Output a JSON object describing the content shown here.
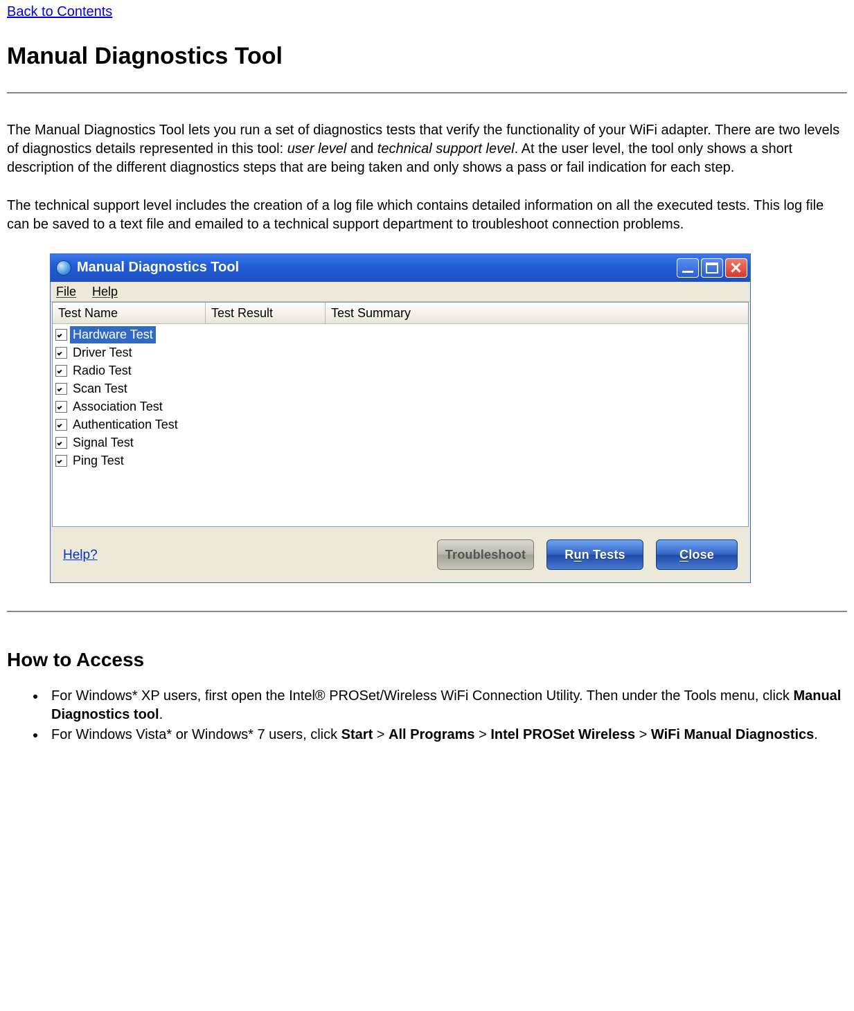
{
  "nav": {
    "back_to_contents": "Back to Contents"
  },
  "h1": "Manual Diagnostics Tool",
  "p1_a": "The Manual Diagnostics Tool lets you run a set of diagnostics tests that verify the functionality of your WiFi adapter. There are two levels of diagnostics details represented in this tool: ",
  "p1_user_level": "user level",
  "p1_and": " and ",
  "p1_tech_level": "technical support level",
  "p1_b": ". At the user level, the tool only shows a short description of the different diagnostics steps that are being taken and only shows a pass or fail indication for each step.",
  "p2": "The technical support level includes the creation of a log file which contains detailed information on all the executed tests. This log file can be saved to a text file and emailed to a technical support department to troubleshoot connection problems.",
  "window": {
    "title": "Manual Diagnostics Tool",
    "menu": {
      "file": "File",
      "help": "Help"
    },
    "columns": {
      "name": "Test Name",
      "result": "Test Result",
      "summary": "Test Summary"
    },
    "rows": [
      {
        "label": "Hardware Test",
        "selected": true
      },
      {
        "label": "Driver Test",
        "selected": false
      },
      {
        "label": "Radio Test",
        "selected": false
      },
      {
        "label": "Scan Test",
        "selected": false
      },
      {
        "label": "Association Test",
        "selected": false
      },
      {
        "label": "Authentication Test",
        "selected": false
      },
      {
        "label": "Signal Test",
        "selected": false
      },
      {
        "label": "Ping Test",
        "selected": false
      }
    ],
    "help_link": "Help?",
    "buttons": {
      "troubleshoot": "Troubleshoot",
      "run_tests_pre": "R",
      "run_tests_ul": "u",
      "run_tests_post": "n Tests",
      "close_ul": "C",
      "close_post": "lose"
    }
  },
  "h2": "How to Access",
  "li1_a": "For Windows* XP users, first open the Intel® PROSet/Wireless WiFi Connection Utility. Then under the Tools menu, click ",
  "li1_b": "Manual Diagnostics tool",
  "li1_c": ".",
  "li2_a": "For Windows Vista* or Windows* 7 users, click ",
  "li2_start": "Start",
  "li2_sep": " > ",
  "li2_allprog": "All Programs",
  "li2_intel": "Intel PROSet Wireless",
  "li2_wifi": "WiFi Manual Diagnostics",
  "li2_end": "."
}
